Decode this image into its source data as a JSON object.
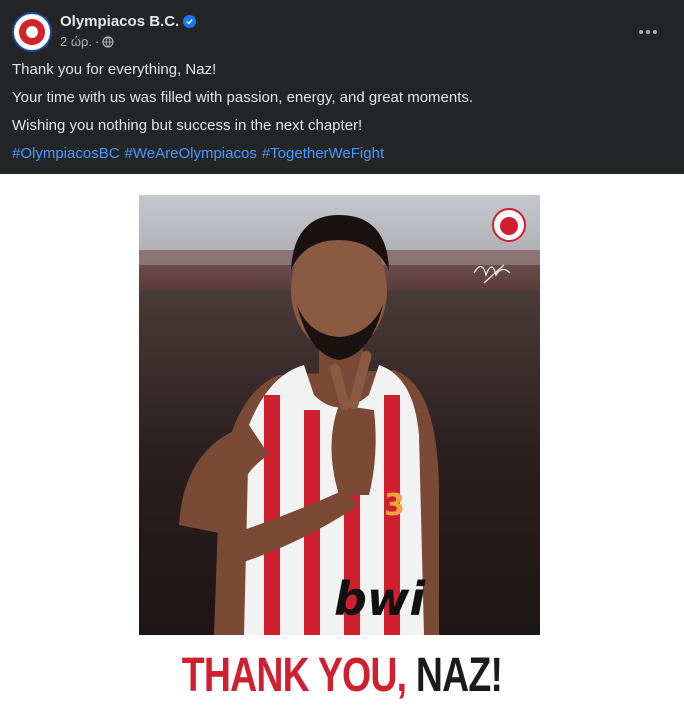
{
  "post": {
    "page_name": "Olympiacos B.C.",
    "time": "2 ώρ.",
    "separator": "·",
    "more_icon": "more-horizontal-icon",
    "globe_icon": "globe-icon",
    "verified_icon": "verified-badge-icon"
  },
  "text": {
    "line1": "Thank you for everything, Naz!",
    "line2": "Your time with us was filled with passion, energy, and great moments.",
    "line3": "Wishing you nothing but success in the next chapter!",
    "hashtags": [
      "#OlympiacosBC",
      "#WeAreOlympiacos",
      "#TogetherWeFight"
    ]
  },
  "image": {
    "jersey_number": "3",
    "sponsor": "bwi",
    "banner_red": "THANK YOU,",
    "banner_dark": "NAZ!"
  },
  "colors": {
    "background": "#242526",
    "text": "#e4e6eb",
    "secondary_text": "#b0b3b8",
    "link": "#4599ff",
    "verified": "#1877f2",
    "olympiacos_red": "#d01f2f"
  }
}
